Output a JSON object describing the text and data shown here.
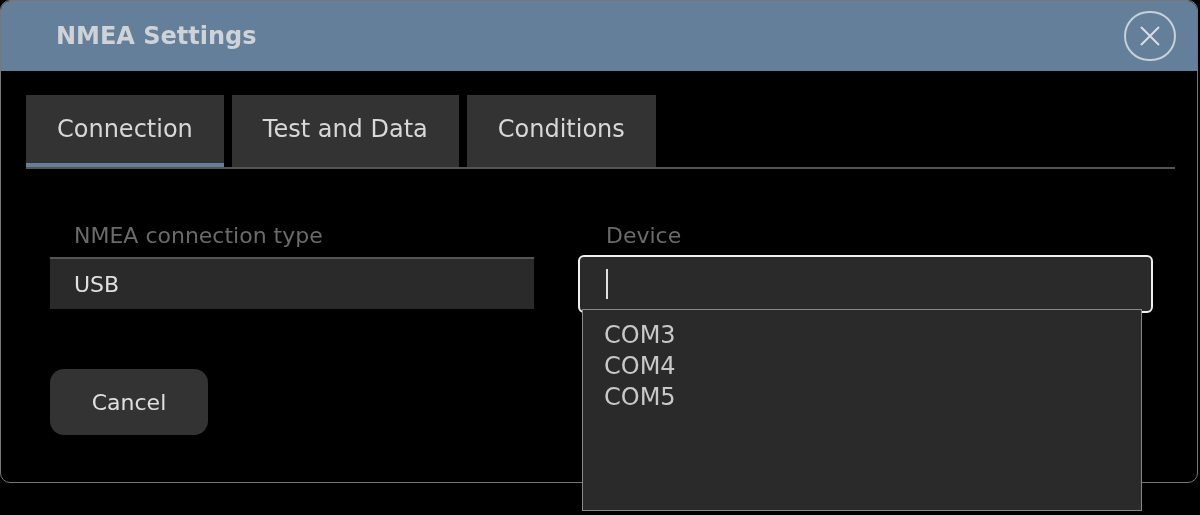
{
  "window": {
    "title": "NMEA Settings"
  },
  "tabs": [
    {
      "label": "Connection",
      "selected": true
    },
    {
      "label": "Test and Data",
      "selected": false
    },
    {
      "label": "Conditions",
      "selected": false
    }
  ],
  "connection_type": {
    "label": "NMEA connection type",
    "value": "USB"
  },
  "device": {
    "label": "Device",
    "focused": true,
    "options": [
      "COM3",
      "COM4",
      "COM5"
    ]
  },
  "buttons": [
    {
      "label": "Cancel"
    }
  ]
}
